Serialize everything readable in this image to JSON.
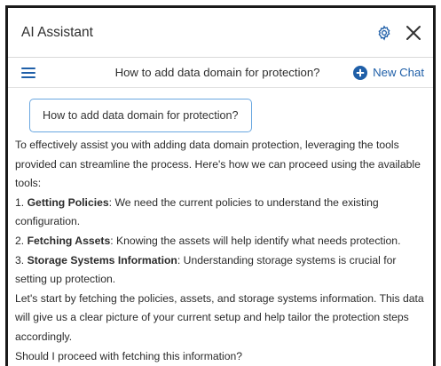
{
  "window": {
    "title": "AI Assistant"
  },
  "header": {
    "chat_title": "How to add data domain for protection?",
    "new_chat_label": "New Chat"
  },
  "conversation": {
    "user_message": "How to add data domain for protection?",
    "answer_intro": "To effectively assist you with adding data domain protection, leveraging the tools provided can streamline the process. Here's how we can proceed using the available tools:",
    "steps": [
      {
        "number": "1.",
        "title": "Getting Policies",
        "text": ": We need the current policies to understand the existing configuration."
      },
      {
        "number": "2.",
        "title": "Fetching Assets",
        "text": ": Knowing the assets will help identify what needs protection."
      },
      {
        "number": "3.",
        "title": "Storage Systems Information",
        "text": ": Understanding storage systems is crucial for setting up protection."
      }
    ],
    "answer_followup": "Let's start by fetching the policies, assets, and storage systems information. This data will give us a clear picture of your current setup and help tailor the protection steps accordingly.",
    "answer_question": "Should I proceed with fetching this information?"
  },
  "icons": {
    "settings": "gear-icon",
    "close": "close-icon",
    "menu": "menu-icon",
    "new_chat": "plus-circle-icon",
    "like": "thumbs-up-icon",
    "dislike": "thumbs-down-icon",
    "copy": "copy-icon",
    "share": "share-icon"
  },
  "colors": {
    "accent": "#1f5fa8",
    "bubble_border": "#6aa7e0"
  }
}
